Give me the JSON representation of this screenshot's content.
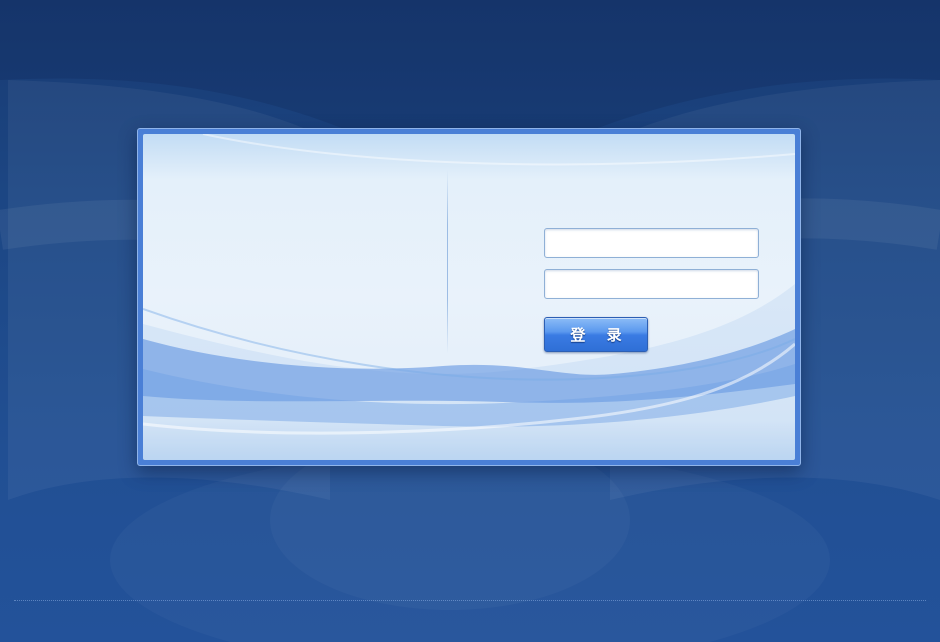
{
  "login_form": {
    "username_value": "",
    "password_value": "",
    "submit_label": "登 录"
  },
  "colors": {
    "background": "#1c4683",
    "panel_frame": "#4a7fd6",
    "panel_body": "#e6f0fa",
    "button": "#3a7be3"
  }
}
